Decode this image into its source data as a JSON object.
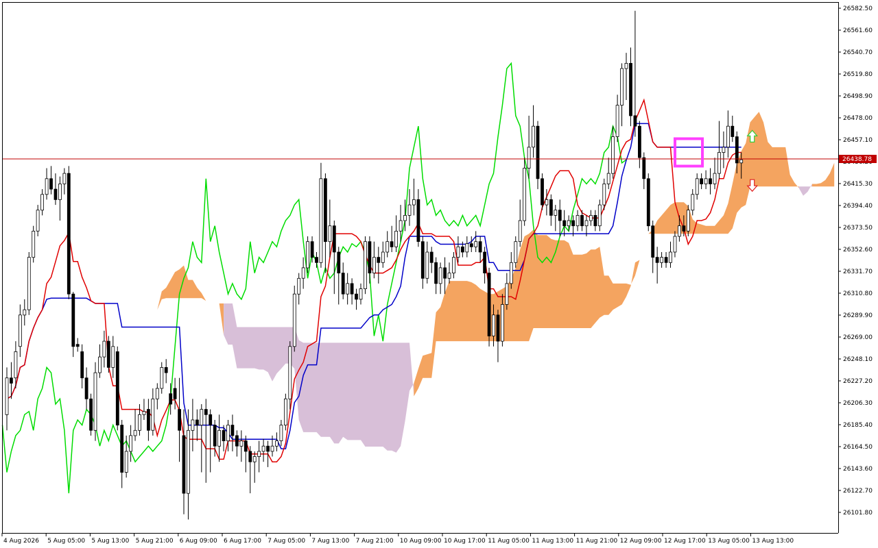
{
  "chart_data": {
    "type": "candlestick",
    "title": "",
    "xlabel": "",
    "ylabel": "",
    "ylim": [
      26085,
      26590
    ],
    "y_ticks": [
      "26582.50",
      "26561.60",
      "26540.70",
      "26519.80",
      "26498.90",
      "26478.00",
      "26457.10",
      "26436.20",
      "26415.30",
      "26394.40",
      "26373.50",
      "26352.60",
      "26331.70",
      "26310.80",
      "26289.90",
      "26269.00",
      "26248.10",
      "26227.20",
      "26206.30",
      "26185.40",
      "26164.50",
      "26143.60",
      "26122.70",
      "26101.80"
    ],
    "x_ticks": [
      "4 Aug 2026",
      "5 Aug 05:00",
      "5 Aug 13:00",
      "5 Aug 21:00",
      "6 Aug 09:00",
      "6 Aug 17:00",
      "7 Aug 05:00",
      "7 Aug 13:00",
      "7 Aug 21:00",
      "10 Aug 09:00",
      "10 Aug 17:00",
      "11 Aug 05:00",
      "11 Aug 13:00",
      "11 Aug 21:00",
      "12 Aug 09:00",
      "12 Aug 17:00",
      "13 Aug 05:00",
      "13 Aug 13:00"
    ],
    "current_price": "26438.78",
    "current_price_value": 26438.78,
    "grid": false,
    "colors": {
      "background": "#ffffff",
      "tenkan": "#e00000",
      "kijun": "#0000c8",
      "chikou": "#00dc00",
      "kumo_bull": "#f4a460",
      "kumo_bear": "#d8bfd8",
      "price_line": "#c00000",
      "highlight": "#ff40ff",
      "arrow_up": "#33cc33",
      "arrow_down": "#e02020"
    },
    "candles": [
      {
        "o": 26195,
        "c": 26230,
        "h": 26240,
        "l": 26180
      },
      {
        "o": 26230,
        "c": 26225,
        "h": 26245,
        "l": 26210
      },
      {
        "o": 26230,
        "c": 26255,
        "h": 26265,
        "l": 26220
      },
      {
        "o": 26260,
        "c": 26290,
        "h": 26300,
        "l": 26250
      },
      {
        "o": 26290,
        "c": 26295,
        "h": 26305,
        "l": 26280
      },
      {
        "o": 26295,
        "c": 26345,
        "h": 26350,
        "l": 26290
      },
      {
        "o": 26345,
        "c": 26370,
        "h": 26375,
        "l": 26340
      },
      {
        "o": 26370,
        "c": 26390,
        "h": 26395,
        "l": 26365
      },
      {
        "o": 26390,
        "c": 26405,
        "h": 26410,
        "l": 26385
      },
      {
        "o": 26405,
        "c": 26420,
        "h": 26430,
        "l": 26400
      },
      {
        "o": 26420,
        "c": 26410,
        "h": 26432,
        "l": 26405
      },
      {
        "o": 26410,
        "c": 26400,
        "h": 26425,
        "l": 26395
      },
      {
        "o": 26400,
        "c": 26415,
        "h": 26422,
        "l": 26380
      },
      {
        "o": 26415,
        "c": 26425,
        "h": 26430,
        "l": 26405
      },
      {
        "o": 26425,
        "c": 26310,
        "h": 26432,
        "l": 26305
      },
      {
        "o": 26310,
        "c": 26260,
        "h": 26312,
        "l": 26250
      },
      {
        "o": 26262,
        "c": 26260,
        "h": 26268,
        "l": 26255
      },
      {
        "o": 26255,
        "c": 26230,
        "h": 26262,
        "l": 26220
      },
      {
        "o": 26230,
        "c": 26210,
        "h": 26240,
        "l": 26200
      },
      {
        "o": 26210,
        "c": 26180,
        "h": 26215,
        "l": 26175
      },
      {
        "o": 26180,
        "c": 26235,
        "h": 26245,
        "l": 26170
      },
      {
        "o": 26235,
        "c": 26250,
        "h": 26262,
        "l": 26230
      },
      {
        "o": 26250,
        "c": 26265,
        "h": 26275,
        "l": 26240
      },
      {
        "o": 26265,
        "c": 26240,
        "h": 26270,
        "l": 26235
      },
      {
        "o": 26240,
        "c": 26260,
        "h": 26270,
        "l": 26230
      },
      {
        "o": 26255,
        "c": 26185,
        "h": 26260,
        "l": 26180
      },
      {
        "o": 26185,
        "c": 26140,
        "h": 26190,
        "l": 26125
      },
      {
        "o": 26140,
        "c": 26160,
        "h": 26175,
        "l": 26135
      },
      {
        "o": 26160,
        "c": 26175,
        "h": 26185,
        "l": 26150
      },
      {
        "o": 26175,
        "c": 26180,
        "h": 26200,
        "l": 26170
      },
      {
        "o": 26180,
        "c": 26195,
        "h": 26205,
        "l": 26175
      },
      {
        "o": 26195,
        "c": 26198,
        "h": 26210,
        "l": 26190
      },
      {
        "o": 26200,
        "c": 26180,
        "h": 26210,
        "l": 26170
      },
      {
        "o": 26180,
        "c": 26210,
        "h": 26220,
        "l": 26175
      },
      {
        "o": 26210,
        "c": 26220,
        "h": 26225,
        "l": 26200
      },
      {
        "o": 26220,
        "c": 26240,
        "h": 26245,
        "l": 26215
      },
      {
        "o": 26240,
        "c": 26235,
        "h": 26248,
        "l": 26225
      },
      {
        "o": 26215,
        "c": 26205,
        "h": 26225,
        "l": 26195
      },
      {
        "o": 26220,
        "c": 26210,
        "h": 26230,
        "l": 26200
      },
      {
        "o": 26200,
        "c": 26180,
        "h": 26230,
        "l": 26150
      },
      {
        "o": 26175,
        "c": 26120,
        "h": 26200,
        "l": 26100
      },
      {
        "o": 26120,
        "c": 26180,
        "h": 26200,
        "l": 26095
      },
      {
        "o": 26180,
        "c": 26190,
        "h": 26210,
        "l": 26160
      },
      {
        "o": 26190,
        "c": 26185,
        "h": 26200,
        "l": 26170
      },
      {
        "o": 26185,
        "c": 26200,
        "h": 26205,
        "l": 26140
      },
      {
        "o": 26200,
        "c": 26195,
        "h": 26210,
        "l": 26130
      },
      {
        "o": 26195,
        "c": 26185,
        "h": 26200,
        "l": 26140
      },
      {
        "o": 26185,
        "c": 26165,
        "h": 26190,
        "l": 26155
      },
      {
        "o": 26165,
        "c": 26180,
        "h": 26195,
        "l": 26150
      },
      {
        "o": 26180,
        "c": 26170,
        "h": 26185,
        "l": 26160
      },
      {
        "o": 26170,
        "c": 26185,
        "h": 26190,
        "l": 26160
      },
      {
        "o": 26185,
        "c": 26175,
        "h": 26195,
        "l": 26160
      },
      {
        "o": 26175,
        "c": 26165,
        "h": 26180,
        "l": 26155
      },
      {
        "o": 26165,
        "c": 26170,
        "h": 26180,
        "l": 26150
      },
      {
        "o": 26170,
        "c": 26160,
        "h": 26175,
        "l": 26140
      },
      {
        "o": 26160,
        "c": 26150,
        "h": 26165,
        "l": 26120
      },
      {
        "o": 26150,
        "c": 26155,
        "h": 26160,
        "l": 26130
      },
      {
        "o": 26155,
        "c": 26160,
        "h": 26170,
        "l": 26140
      },
      {
        "o": 26160,
        "c": 26165,
        "h": 26172,
        "l": 26150
      },
      {
        "o": 26165,
        "c": 26160,
        "h": 26170,
        "l": 26145
      },
      {
        "o": 26160,
        "c": 26165,
        "h": 26175,
        "l": 26155
      },
      {
        "o": 26165,
        "c": 26170,
        "h": 26178,
        "l": 26160
      },
      {
        "o": 26170,
        "c": 26185,
        "h": 26190,
        "l": 26165
      },
      {
        "o": 26185,
        "c": 26210,
        "h": 26215,
        "l": 26180
      },
      {
        "o": 26210,
        "c": 26260,
        "h": 26265,
        "l": 26200
      },
      {
        "o": 26260,
        "c": 26310,
        "h": 26318,
        "l": 26255
      },
      {
        "o": 26310,
        "c": 26325,
        "h": 26330,
        "l": 26300
      },
      {
        "o": 26325,
        "c": 26335,
        "h": 26345,
        "l": 26315
      },
      {
        "o": 26335,
        "c": 26360,
        "h": 26365,
        "l": 26330
      },
      {
        "o": 26360,
        "c": 26345,
        "h": 26365,
        "l": 26340
      },
      {
        "o": 26345,
        "c": 26340,
        "h": 26350,
        "l": 26335
      },
      {
        "o": 26340,
        "c": 26420,
        "h": 26435,
        "l": 26335
      },
      {
        "o": 26420,
        "c": 26360,
        "h": 26425,
        "l": 26330
      },
      {
        "o": 26360,
        "c": 26375,
        "h": 26400,
        "l": 26345
      },
      {
        "o": 26375,
        "c": 26350,
        "h": 26380,
        "l": 26310
      },
      {
        "o": 26350,
        "c": 26330,
        "h": 26355,
        "l": 26300
      },
      {
        "o": 26330,
        "c": 26310,
        "h": 26340,
        "l": 26305
      },
      {
        "o": 26310,
        "c": 26320,
        "h": 26330,
        "l": 26300
      },
      {
        "o": 26320,
        "c": 26310,
        "h": 26325,
        "l": 26300
      },
      {
        "o": 26310,
        "c": 26305,
        "h": 26315,
        "l": 26295
      },
      {
        "o": 26305,
        "c": 26315,
        "h": 26320,
        "l": 26300
      },
      {
        "o": 26315,
        "c": 26360,
        "h": 26365,
        "l": 26310
      },
      {
        "o": 26360,
        "c": 26330,
        "h": 26365,
        "l": 26320
      },
      {
        "o": 26330,
        "c": 26345,
        "h": 26360,
        "l": 26325
      },
      {
        "o": 26345,
        "c": 26340,
        "h": 26355,
        "l": 26320
      },
      {
        "o": 26340,
        "c": 26350,
        "h": 26360,
        "l": 26335
      },
      {
        "o": 26350,
        "c": 26360,
        "h": 26370,
        "l": 26345
      },
      {
        "o": 26360,
        "c": 26355,
        "h": 26375,
        "l": 26350
      },
      {
        "o": 26355,
        "c": 26370,
        "h": 26385,
        "l": 26350
      },
      {
        "o": 26370,
        "c": 26380,
        "h": 26395,
        "l": 26360
      },
      {
        "o": 26380,
        "c": 26385,
        "h": 26400,
        "l": 26370
      },
      {
        "o": 26385,
        "c": 26395,
        "h": 26410,
        "l": 26375
      },
      {
        "o": 26395,
        "c": 26400,
        "h": 26420,
        "l": 26385
      },
      {
        "o": 26400,
        "c": 26360,
        "h": 26410,
        "l": 26355
      },
      {
        "o": 26360,
        "c": 26325,
        "h": 26365,
        "l": 26315
      },
      {
        "o": 26325,
        "c": 26350,
        "h": 26360,
        "l": 26320
      },
      {
        "o": 26350,
        "c": 26340,
        "h": 26355,
        "l": 26330
      },
      {
        "o": 26340,
        "c": 26320,
        "h": 26345,
        "l": 26310
      },
      {
        "o": 26320,
        "c": 26335,
        "h": 26340,
        "l": 26310
      },
      {
        "o": 26335,
        "c": 26325,
        "h": 26345,
        "l": 26310
      },
      {
        "o": 26325,
        "c": 26330,
        "h": 26340,
        "l": 26320
      },
      {
        "o": 26330,
        "c": 26345,
        "h": 26350,
        "l": 26325
      },
      {
        "o": 26345,
        "c": 26355,
        "h": 26365,
        "l": 26340
      },
      {
        "o": 26355,
        "c": 26350,
        "h": 26360,
        "l": 26345
      },
      {
        "o": 26350,
        "c": 26358,
        "h": 26365,
        "l": 26345
      },
      {
        "o": 26358,
        "c": 26355,
        "h": 26365,
        "l": 26350
      },
      {
        "o": 26355,
        "c": 26360,
        "h": 26370,
        "l": 26350
      },
      {
        "o": 26360,
        "c": 26350,
        "h": 26365,
        "l": 26340
      },
      {
        "o": 26350,
        "c": 26330,
        "h": 26355,
        "l": 26320
      },
      {
        "o": 26330,
        "c": 26270,
        "h": 26335,
        "l": 26260
      },
      {
        "o": 26270,
        "c": 26290,
        "h": 26300,
        "l": 26260
      },
      {
        "o": 26290,
        "c": 26265,
        "h": 26295,
        "l": 26245
      },
      {
        "o": 26265,
        "c": 26300,
        "h": 26310,
        "l": 26260
      },
      {
        "o": 26300,
        "c": 26320,
        "h": 26330,
        "l": 26295
      },
      {
        "o": 26320,
        "c": 26340,
        "h": 26350,
        "l": 26315
      },
      {
        "o": 26340,
        "c": 26360,
        "h": 26365,
        "l": 26335
      },
      {
        "o": 26360,
        "c": 26380,
        "h": 26400,
        "l": 26355
      },
      {
        "o": 26380,
        "c": 26430,
        "h": 26440,
        "l": 26375
      },
      {
        "o": 26430,
        "c": 26450,
        "h": 26480,
        "l": 26420
      },
      {
        "o": 26450,
        "c": 26470,
        "h": 26490,
        "l": 26440
      },
      {
        "o": 26470,
        "c": 26420,
        "h": 26475,
        "l": 26410
      },
      {
        "o": 26420,
        "c": 26395,
        "h": 26425,
        "l": 26390
      },
      {
        "o": 26395,
        "c": 26400,
        "h": 26410,
        "l": 26385
      },
      {
        "o": 26400,
        "c": 26385,
        "h": 26405,
        "l": 26375
      },
      {
        "o": 26385,
        "c": 26390,
        "h": 26395,
        "l": 26370
      },
      {
        "o": 26390,
        "c": 26380,
        "h": 26400,
        "l": 26365
      },
      {
        "o": 26380,
        "c": 26375,
        "h": 26390,
        "l": 26365
      },
      {
        "o": 26375,
        "c": 26380,
        "h": 26385,
        "l": 26370
      },
      {
        "o": 26380,
        "c": 26375,
        "h": 26385,
        "l": 26365
      },
      {
        "o": 26375,
        "c": 26385,
        "h": 26390,
        "l": 26370
      },
      {
        "o": 26385,
        "c": 26375,
        "h": 26390,
        "l": 26370
      },
      {
        "o": 26375,
        "c": 26380,
        "h": 26385,
        "l": 26365
      },
      {
        "o": 26380,
        "c": 26385,
        "h": 26390,
        "l": 26375
      },
      {
        "o": 26385,
        "c": 26375,
        "h": 26390,
        "l": 26370
      },
      {
        "o": 26375,
        "c": 26395,
        "h": 26400,
        "l": 26370
      },
      {
        "o": 26395,
        "c": 26415,
        "h": 26420,
        "l": 26390
      },
      {
        "o": 26415,
        "c": 26425,
        "h": 26440,
        "l": 26410
      },
      {
        "o": 26425,
        "c": 26460,
        "h": 26470,
        "l": 26420
      },
      {
        "o": 26460,
        "c": 26490,
        "h": 26500,
        "l": 26455
      },
      {
        "o": 26490,
        "c": 26525,
        "h": 26530,
        "l": 26470
      },
      {
        "o": 26525,
        "c": 26530,
        "h": 26540,
        "l": 26495
      },
      {
        "o": 26530,
        "c": 26480,
        "h": 26545,
        "l": 26470
      },
      {
        "o": 26480,
        "c": 26470,
        "h": 26580,
        "l": 26460
      },
      {
        "o": 26470,
        "c": 26440,
        "h": 26475,
        "l": 26430
      },
      {
        "o": 26440,
        "c": 26420,
        "h": 26445,
        "l": 26410
      },
      {
        "o": 26420,
        "c": 26375,
        "h": 26425,
        "l": 26370
      },
      {
        "o": 26375,
        "c": 26345,
        "h": 26380,
        "l": 26330
      },
      {
        "o": 26345,
        "c": 26340,
        "h": 26355,
        "l": 26320
      },
      {
        "o": 26340,
        "c": 26345,
        "h": 26350,
        "l": 26335
      },
      {
        "o": 26345,
        "c": 26340,
        "h": 26350,
        "l": 26335
      },
      {
        "o": 26340,
        "c": 26350,
        "h": 26360,
        "l": 26335
      },
      {
        "o": 26350,
        "c": 26365,
        "h": 26370,
        "l": 26345
      },
      {
        "o": 26365,
        "c": 26375,
        "h": 26385,
        "l": 26360
      },
      {
        "o": 26375,
        "c": 26370,
        "h": 26385,
        "l": 26365
      },
      {
        "o": 26370,
        "c": 26390,
        "h": 26395,
        "l": 26365
      },
      {
        "o": 26390,
        "c": 26405,
        "h": 26410,
        "l": 26385
      },
      {
        "o": 26405,
        "c": 26420,
        "h": 26425,
        "l": 26400
      },
      {
        "o": 26420,
        "c": 26415,
        "h": 26425,
        "l": 26410
      },
      {
        "o": 26415,
        "c": 26420,
        "h": 26428,
        "l": 26410
      },
      {
        "o": 26420,
        "c": 26415,
        "h": 26430,
        "l": 26405
      },
      {
        "o": 26415,
        "c": 26425,
        "h": 26440,
        "l": 26410
      },
      {
        "o": 26425,
        "c": 26445,
        "h": 26475,
        "l": 26420
      },
      {
        "o": 26445,
        "c": 26450,
        "h": 26465,
        "l": 26430
      },
      {
        "o": 26450,
        "c": 26470,
        "h": 26485,
        "l": 26440
      },
      {
        "o": 26470,
        "c": 26460,
        "h": 26480,
        "l": 26455
      },
      {
        "o": 26460,
        "c": 26435,
        "h": 26465,
        "l": 26425
      },
      {
        "o": 26435,
        "c": 26438,
        "h": 26445,
        "l": 26420
      }
    ]
  }
}
